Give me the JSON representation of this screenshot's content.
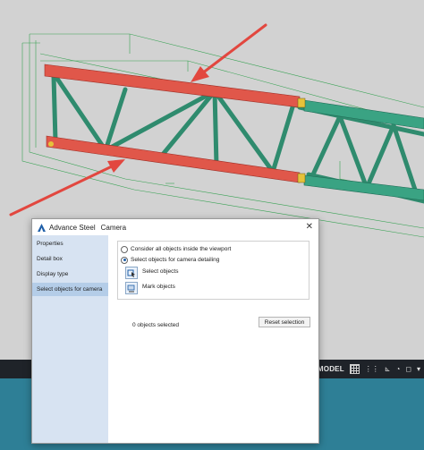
{
  "dialog": {
    "app_name": "Advance Steel",
    "title": "Camera",
    "close_glyph": "✕",
    "logo_icon": "advance-steel-logo-icon",
    "sidebar": {
      "items": [
        {
          "label": "Properties",
          "active": false
        },
        {
          "label": "Detail box",
          "active": false
        },
        {
          "label": "Display type",
          "active": false
        },
        {
          "label": "Select objects for camera",
          "active": true
        }
      ]
    },
    "options": {
      "radio_all": {
        "label": "Consider all objects inside the viewport",
        "checked": false
      },
      "radio_select": {
        "label": "Select objects for camera detailing",
        "checked": true
      }
    },
    "actions": {
      "select_objects": {
        "label": "Select objects",
        "icon": "select-objects-icon"
      },
      "mark_objects": {
        "label": "Mark objects",
        "icon": "mark-objects-icon"
      }
    },
    "selection_count": "0 objects selected",
    "reset_label": "Reset selection"
  },
  "statusbar": {
    "model_label": "MODEL",
    "icons": [
      "grid-icon",
      "snap-icon",
      "ortho-icon",
      "polar-icon",
      "osnap-icon",
      "dropdown-icon"
    ]
  },
  "colors": {
    "truss_chord_highlight": "#e0574a",
    "truss_member": "#3aa383",
    "arrow": "#e2473f",
    "sidebar_bg": "#d7e3f2",
    "sidebar_active": "#b4cde8",
    "taskbar_blue": "#2e7f96"
  }
}
